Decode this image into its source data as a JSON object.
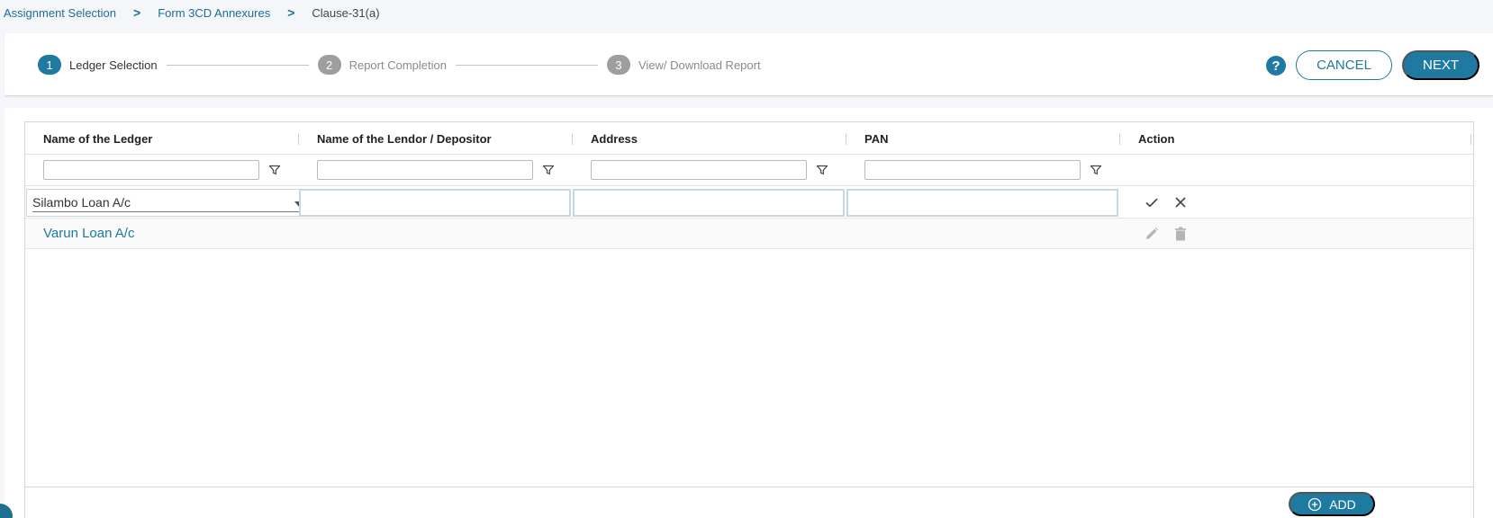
{
  "breadcrumb": {
    "items": [
      "Assignment Selection",
      "Form 3CD Annexures"
    ],
    "separator": ">",
    "current": "Clause-31(a)"
  },
  "stepper": {
    "steps": [
      {
        "number": "1",
        "label": "Ledger Selection",
        "state": "active"
      },
      {
        "number": "2",
        "label": "Report Completion",
        "state": "inactive"
      },
      {
        "number": "3",
        "label": "View/ Download Report",
        "state": "inactive"
      }
    ]
  },
  "toolbar": {
    "help_label": "?",
    "cancel_label": "CANCEL",
    "next_label": "NEXT"
  },
  "grid": {
    "columns": [
      "Name of the Ledger",
      "Name of the Lendor / Depositor",
      "Address",
      "PAN",
      "Action"
    ],
    "filters": {
      "ledger": "",
      "lender": "",
      "address": "",
      "pan": ""
    },
    "edit_row": {
      "ledger_value": "Silambo Loan A/c",
      "lender_value": "",
      "address_value": "",
      "pan_value": ""
    },
    "rows": [
      {
        "ledger": "Varun Loan A/c",
        "lender": "",
        "address": "",
        "pan": ""
      }
    ],
    "add_label": "ADD"
  },
  "icons": {
    "filter": "filter-icon",
    "confirm": "check-icon",
    "cancel": "close-icon",
    "edit": "pencil-icon",
    "delete": "trash-icon",
    "add": "plus-circle-icon",
    "help": "help-icon",
    "dropdown": "caret-down-icon"
  },
  "colors": {
    "accent": "#1e7aa0",
    "link": "#1e6f92",
    "inactive_step": "#9e9e9e",
    "disabled_icon": "#b5b5b5"
  }
}
